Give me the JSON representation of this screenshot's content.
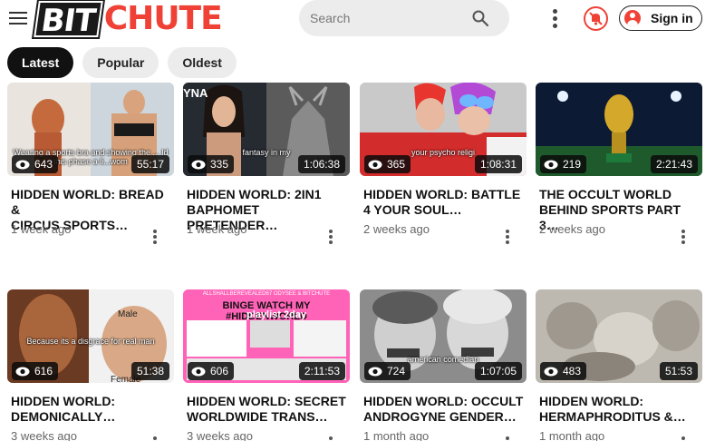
{
  "header": {
    "logo_bit": "BIT",
    "logo_chute": "CHUTE",
    "search_placeholder": "Search",
    "signin_label": "Sign in",
    "icons": [
      "menu-icon",
      "search-icon",
      "more-vertical-icon",
      "notifications-off-icon",
      "user-icon"
    ]
  },
  "colors": {
    "brand_red": "#ef4136",
    "tab_active_bg": "#111111",
    "tab_bg": "#ececec"
  },
  "tabs": [
    {
      "label": "Latest",
      "active": true
    },
    {
      "label": "Popular",
      "active": false
    },
    {
      "label": "Oldest",
      "active": false
    }
  ],
  "videos": [
    {
      "title_line1": "HIDDEN WORLD: BREAD &",
      "title_line2": "CIRCUS SPORTS…",
      "views": "643",
      "duration": "55:17",
      "age": "1 week ago",
      "overlay": "Wearing a sports bra and showing the ... ld this phase a li...wom"
    },
    {
      "title_line1": "HIDDEN WORLD: 2IN1",
      "title_line2": "BAPHOMET PRETENDER…",
      "views": "335",
      "duration": "1:06:38",
      "age": "1 week ago",
      "overlay": "fantasy in my"
    },
    {
      "title_line1": "HIDDEN WORLD: BATTLE",
      "title_line2": "4 YOUR SOUL…",
      "views": "365",
      "duration": "1:08:31",
      "age": "2 weeks ago",
      "overlay": "your psycho religi"
    },
    {
      "title_line1": "THE OCCULT WORLD",
      "title_line2": "BEHIND SPORTS PART 3…",
      "views": "219",
      "duration": "2:21:43",
      "age": "2 weeks ago",
      "overlay": ""
    },
    {
      "title_line1": "HIDDEN WORLD:",
      "title_line2": "DEMONICALLY…",
      "views": "616",
      "duration": "51:38",
      "age": "3 weeks ago",
      "overlay": "Because its a disgrace for real man"
    },
    {
      "title_line1": "HIDDEN WORLD: SECRET",
      "title_line2": "WORLDWIDE TRANS…",
      "views": "606",
      "duration": "2:11:53",
      "age": "3 weeks ago",
      "overlay": "BINGE WATCH MY #HIDDENWORLD"
    },
    {
      "title_line1": "HIDDEN WORLD: OCCULT",
      "title_line2": "ANDROGYNE GENDER…",
      "views": "724",
      "duration": "1:07:05",
      "age": "1 month ago",
      "overlay": "american comedian"
    },
    {
      "title_line1": "HIDDEN WORLD:",
      "title_line2": "HERMAPHRODITUS &…",
      "views": "483",
      "duration": "51:53",
      "age": "1 month ago",
      "overlay": ""
    }
  ],
  "thumb_text": {
    "v2_logo": "YNA",
    "v5_label_male": "Male",
    "v5_label_female": "Female",
    "v6_top": "ALLSHALLBEREVEALED67 ODYSEE & BITCHUTE",
    "v6_sub": "playlist 2day"
  }
}
